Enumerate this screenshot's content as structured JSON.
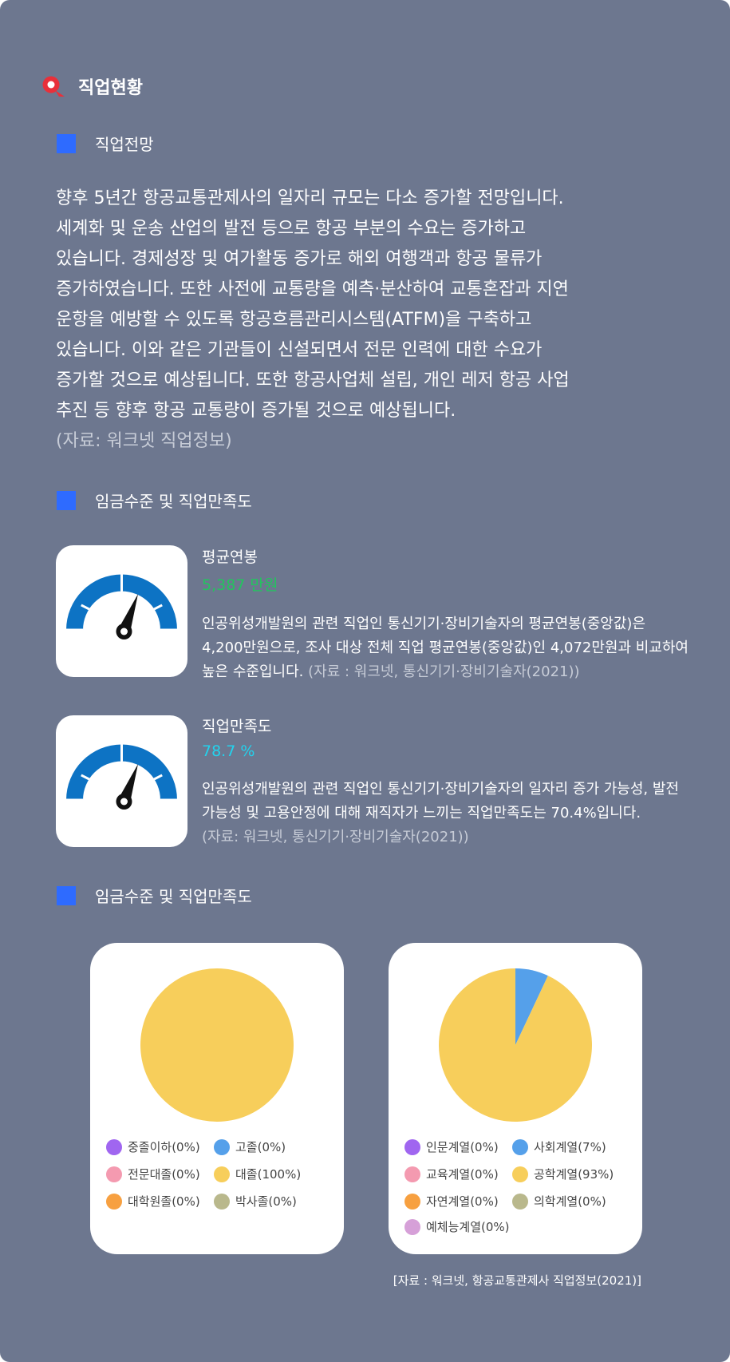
{
  "page_title": "직업현황",
  "logo": {
    "icon": "search-magnifier-icon",
    "color": "#e8303a"
  },
  "outlook": {
    "heading": "직업전망",
    "lines": [
      "향후 5년간 항공교통관제사의 일자리 규모는 다소 증가할 전망입니다.",
      "세계화 및 운송 산업의 발전 등으로 항공 부분의 수요는 증가하고",
      "있습니다. 경제성장 및 여가활동 증가로 해외 여행객과 항공 물류가",
      "증가하였습니다. 또한 사전에 교통량을 예측·분산하여 교통혼잡과 지연",
      "운항을 예방할 수 있도록 항공흐름관리시스템(ATFM)을 구축하고",
      "있습니다. 이와 같은 기관들이 신설되면서 전문 인력에 대한 수요가",
      "증가할 것으로 예상됩니다. 또한 항공사업체 설립, 개인 레저 항공 사업",
      "추진 등 향후 항공 교통량이 증가될 것으로 예상됩니다."
    ],
    "source": "(자료: 워크넷 직업정보)"
  },
  "wage": {
    "heading": "임금수준 및 직업만족도",
    "salary": {
      "icon": "gauge-icon",
      "label": "평균연봉",
      "value": "5,387 만원",
      "value_color": "#22c55e",
      "desc": "인공위성개발원의 관련 직업인 통신기기·장비기술자의 평균연봉(중앙값)은 4,200만원으로, 조사 대상 전체 직업 평균연봉(중앙값)인 4,072만원과 비교하여 높은 수준입니다.",
      "source": "(자료 : 워크넷, 통신기기·장비기술자(2021))"
    },
    "satisfaction": {
      "icon": "gauge-icon",
      "label": "직업만족도",
      "value": "78.7 %",
      "value_color": "#22d3ee",
      "desc": "인공위성개발원의 관련 직업인 통신기기·장비기술자의 일자리 증가 가능성, 발전가능성 및 고용안정에 대해 재직자가 느끼는 직업만족도는 70.4%입니다.",
      "source": "(자료: 워크넷, 통신기기·장비기술자(2021))"
    }
  },
  "distribution": {
    "heading": "임금수준 및 직업만족도",
    "source": "[자료 : 워크넷, 항공교통관제사 직업정보(2021)]"
  },
  "chart_data": [
    {
      "type": "pie",
      "labels": [
        "중졸이하",
        "고졸",
        "전문대졸",
        "대졸",
        "대학원졸",
        "박사졸"
      ],
      "values": [
        0,
        0,
        0,
        100,
        0,
        0
      ],
      "legend": [
        "중졸이하(0%)",
        "고졸(0%)",
        "전문대졸(0%)",
        "대졸(100%)",
        "대학원졸(0%)",
        "박사졸(0%)"
      ],
      "colors": [
        "#a066f0",
        "#55a0ea",
        "#f49ab0",
        "#f7ce5b",
        "#f7a040",
        "#b9b88c"
      ]
    },
    {
      "type": "pie",
      "labels": [
        "인문계열",
        "사회계열",
        "교육계열",
        "공학계열",
        "자연계열",
        "의학계열",
        "예체능계열"
      ],
      "values": [
        0,
        7,
        0,
        93,
        0,
        0,
        0
      ],
      "legend": [
        "인문계열(0%)",
        "사회계열(7%)",
        "교육계열(0%)",
        "공학계열(93%)",
        "자연계열(0%)",
        "의학계열(0%)",
        "예체능계열(0%)"
      ],
      "colors": [
        "#a066f0",
        "#55a0ea",
        "#f49ab0",
        "#f7ce5b",
        "#f7a040",
        "#b9b88c",
        "#d6a0d8"
      ]
    }
  ]
}
